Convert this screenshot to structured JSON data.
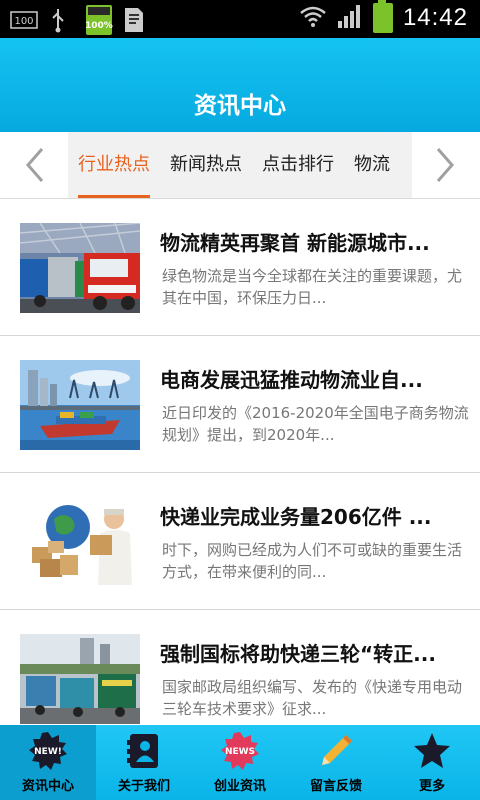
{
  "status_bar": {
    "time": "14:42",
    "battery_percent_label": "100%",
    "notification_box": "100"
  },
  "header": {
    "title": "资讯中心"
  },
  "tabs": {
    "items": [
      {
        "label": "行业热点",
        "active": true
      },
      {
        "label": "新闻热点",
        "active": false
      },
      {
        "label": "点击排行",
        "active": false
      },
      {
        "label": "物流",
        "active": false
      }
    ]
  },
  "news": [
    {
      "title": "物流精英再聚首 新能源城市...",
      "summary": "绿色物流是当今全球都在关注的重要课题，尤其在中国，环保压力日...",
      "image": "trucks-photo"
    },
    {
      "title": "电商发展迅猛推动物流业自...",
      "summary": "近日印发的《2016-2020年全国电子商务物流规划》提出，到2020年...",
      "image": "port-ship-photo"
    },
    {
      "title": "快递业完成业务量206亿件 ...",
      "summary": "时下，网购已经成为人们不可或缺的重要生活方式，在带来便利的同...",
      "image": "courier-globe-photo"
    },
    {
      "title": "强制国标将助快递三轮“转正...",
      "summary": "国家邮政局组织编写、发布的《快递专用电动三轮车技术要求》征求...",
      "image": "tricycle-photo"
    }
  ],
  "bottom_nav": [
    {
      "label": "资讯中心",
      "icon": "new-badge-icon",
      "active": true
    },
    {
      "label": "关于我们",
      "icon": "contact-card-icon",
      "active": false
    },
    {
      "label": "创业资讯",
      "icon": "news-badge-icon",
      "active": false
    },
    {
      "label": "留言反馈",
      "icon": "pencil-icon",
      "active": false
    },
    {
      "label": "更多",
      "icon": "star-icon",
      "active": false
    }
  ],
  "colors": {
    "accent": "#e8621f",
    "header": "#06a9df",
    "bottom_bar": "#0ab4e7"
  }
}
